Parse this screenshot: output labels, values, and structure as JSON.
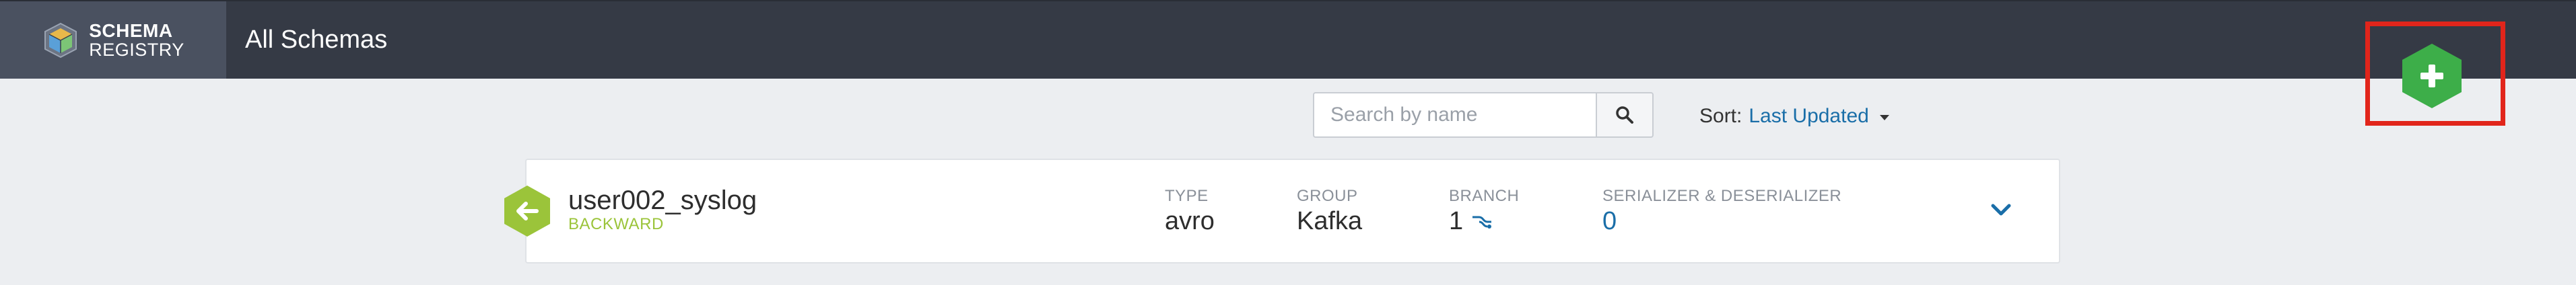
{
  "header": {
    "logo_line1": "SCHEMA",
    "logo_line2": "REGISTRY",
    "title": "All Schemas",
    "add_button_icon": "plus-icon"
  },
  "toolbar": {
    "search_placeholder": "Search by name",
    "search_value": "",
    "sort_label": "Sort:",
    "sort_value": "Last Updated"
  },
  "schemas": [
    {
      "name": "user002_syslog",
      "compatibility": "BACKWARD",
      "type_label": "TYPE",
      "type": "avro",
      "group_label": "GROUP",
      "group": "Kafka",
      "branch_label": "BRANCH",
      "branch": "1",
      "serdes_label": "SERIALIZER & DESERIALIZER",
      "serdes": "0"
    }
  ],
  "colors": {
    "header_bg": "#353a45",
    "logo_bg": "#4a5160",
    "add_button": "#3dae49",
    "highlight": "#e1251b",
    "link": "#1a6ea8",
    "compat_badge": "#9bc43a"
  }
}
